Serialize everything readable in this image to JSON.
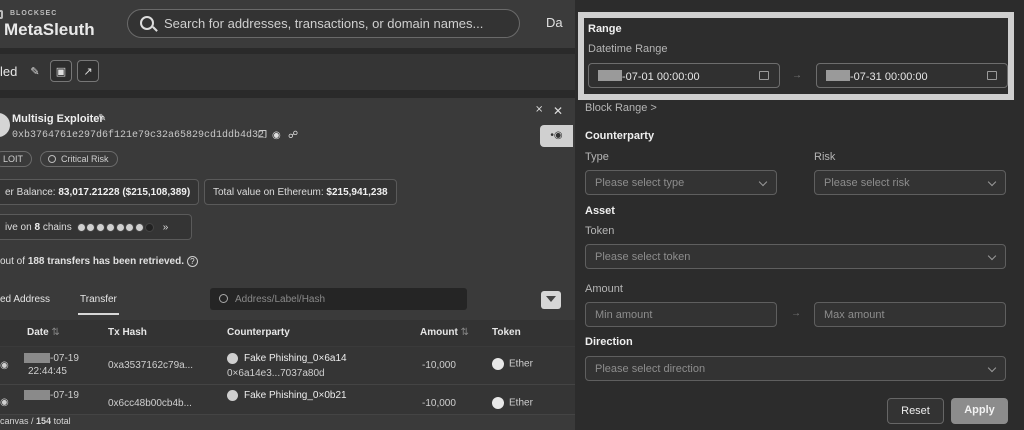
{
  "header": {
    "logo_small": "BLOCKSEC",
    "logo_big": "MetaSleuth",
    "search_placeholder": "Search for addresses, transactions, or domain names...",
    "nav_partial": "Da"
  },
  "toolbar": {
    "title_partial": "led"
  },
  "entity": {
    "name": "Multisig Exploiter",
    "address": "0xb3764761e297d6f121e79c32a65829cd1ddb4d32",
    "tags": [
      "LOIT",
      "Critical Risk"
    ],
    "balance_label": "er Balance:",
    "balance_value": "83,017.21228 ($215,108,389)",
    "total_label": "Total value on Ethereum:",
    "total_value": "$215,941,238",
    "chains_prefix": "ive on",
    "chains_count": "8",
    "chains_suffix": "chains"
  },
  "retrieved": {
    "prefix": "out of",
    "count": "188",
    "suffix": "transfers has been retrieved."
  },
  "tabs": [
    {
      "label": "ed Address"
    },
    {
      "label": "Transfer",
      "active": true
    }
  ],
  "filter_placeholder": "Address/Label/Hash",
  "table": {
    "headers": [
      "Date",
      "Tx Hash",
      "Counterparty",
      "Amount",
      "Token"
    ],
    "rows": [
      {
        "date": "-07-19",
        "time": "22:44:45",
        "hash": "0xa3537162c79a...",
        "cp_name": "Fake Phishing_0×6a14",
        "cp_addr": "0×6a14e3...7037a80d",
        "amount": "-10,000",
        "token": "Ether"
      },
      {
        "date": "-07-19",
        "time": "",
        "hash": "0x6cc48b00cb4b...",
        "cp_name": "Fake Phishing_0×0b21",
        "cp_addr": "",
        "amount": "-10,000",
        "token": "Ether"
      }
    ]
  },
  "footer": {
    "prefix": "canvas /",
    "count": "154",
    "suffix": "total"
  },
  "drawer": {
    "range": {
      "title": "Range",
      "datetime_label": "Datetime Range",
      "start": "-07-01 00:00:00",
      "end": "-07-31 00:00:00",
      "block_range": "Block Range >"
    },
    "counterparty": {
      "title": "Counterparty",
      "type_label": "Type",
      "type_placeholder": "Please select type",
      "risk_label": "Risk",
      "risk_placeholder": "Please select risk"
    },
    "asset": {
      "title": "Asset",
      "token_label": "Token",
      "token_placeholder": "Please select token",
      "amount_label": "Amount",
      "min_placeholder": "Min amount",
      "max_placeholder": "Max amount"
    },
    "direction": {
      "title": "Direction",
      "placeholder": "Please select direction"
    },
    "reset_label": "Reset",
    "apply_label": "Apply"
  }
}
